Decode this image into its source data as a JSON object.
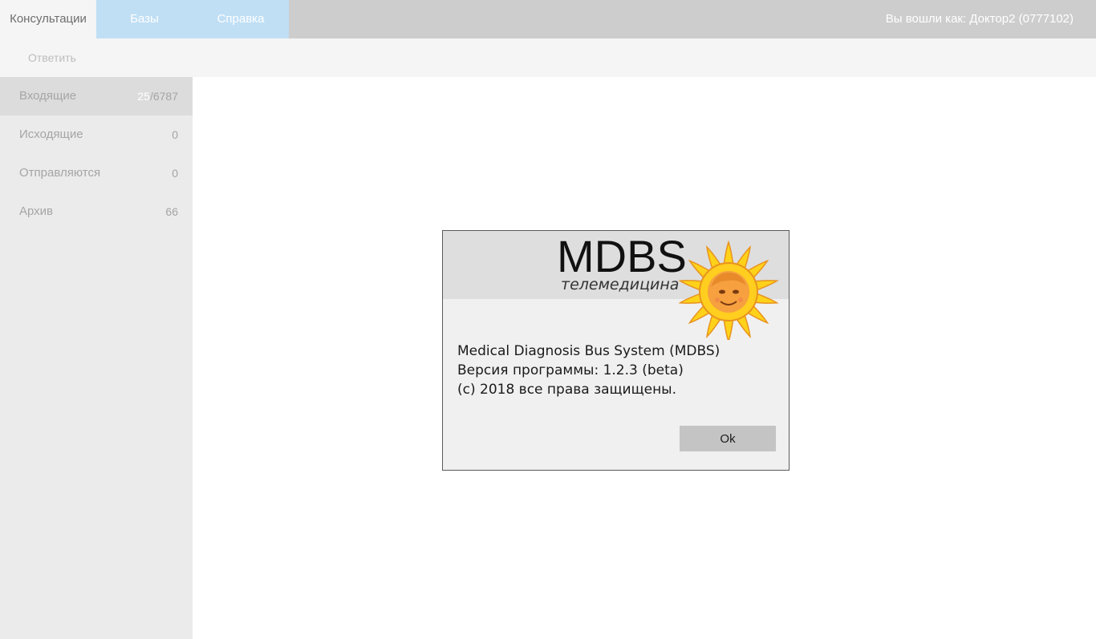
{
  "header": {
    "tabs": [
      "Консультации",
      "Базы",
      "Справка"
    ],
    "user": "Вы вошли как: Доктор2 (0777102)"
  },
  "toolbar": {
    "reply_label": "Ответить"
  },
  "sidebar": {
    "items": [
      {
        "label": "Входящие",
        "unread": "25",
        "sep": "/",
        "count": "6787"
      },
      {
        "label": "Исходящие",
        "count": "0"
      },
      {
        "label": "Отправляются",
        "count": "0"
      },
      {
        "label": "Архив",
        "count": "66"
      }
    ]
  },
  "dialog": {
    "brand": "MDBS",
    "brand_sub": "телемедицина",
    "lines": [
      "Medical Diagnosis Bus System (MDBS)",
      "Версия программы: 1.2.3 (beta)",
      "(с) 2018 все права защищены."
    ],
    "ok_label": "Ok",
    "logo": "sun-mascot-icon"
  },
  "colors": {
    "topbar": "#cdcdcd",
    "tab_accent": "#c0dff5",
    "sidebar": "#ebebeb",
    "sun_petal": "#ffd21a",
    "sun_face": "#f7a13a"
  }
}
